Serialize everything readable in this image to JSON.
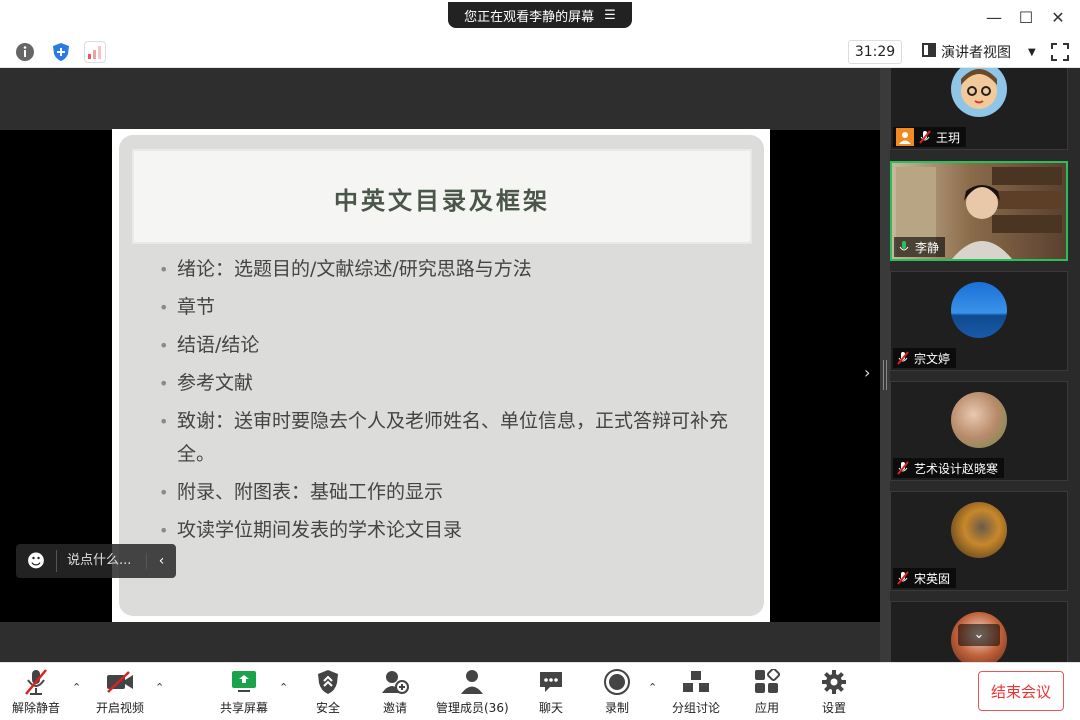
{
  "titlebar": {
    "viewing_text": "您正在观看李静的屏幕"
  },
  "toolbar": {
    "timer": "31:29",
    "view_label": "演讲者视图"
  },
  "slide": {
    "title": "中英文目录及框架",
    "bullets": [
      "绪论：选题目的/文献综述/研究思路与方法",
      "章节",
      "结语/结论",
      "参考文献",
      "致谢：送审时要隐去个人及老师姓名、单位信息，正式答辩可补充全。",
      "附录、附图表：基础工作的显示",
      "攻读学位期间发表的学术论文目录"
    ]
  },
  "chat": {
    "placeholder": "说点什么..."
  },
  "participants": [
    {
      "name": "王玥"
    },
    {
      "name": "李静"
    },
    {
      "name": "宗文婷"
    },
    {
      "name": "艺术设计赵晓寒"
    },
    {
      "name": "宋英囡"
    }
  ],
  "bottombar": {
    "unmute": "解除静音",
    "start_video": "开启视频",
    "share_screen": "共享屏幕",
    "security": "安全",
    "invite": "邀请",
    "manage_members": "管理成员(36)",
    "chat": "聊天",
    "record": "录制",
    "breakout": "分组讨论",
    "apps": "应用",
    "settings": "设置",
    "end_meeting": "结束会议"
  },
  "colors": {
    "active_border": "#27c05a",
    "end_red": "#e33333",
    "mute_red": "#e02020",
    "share_green": "#1aa34a"
  }
}
